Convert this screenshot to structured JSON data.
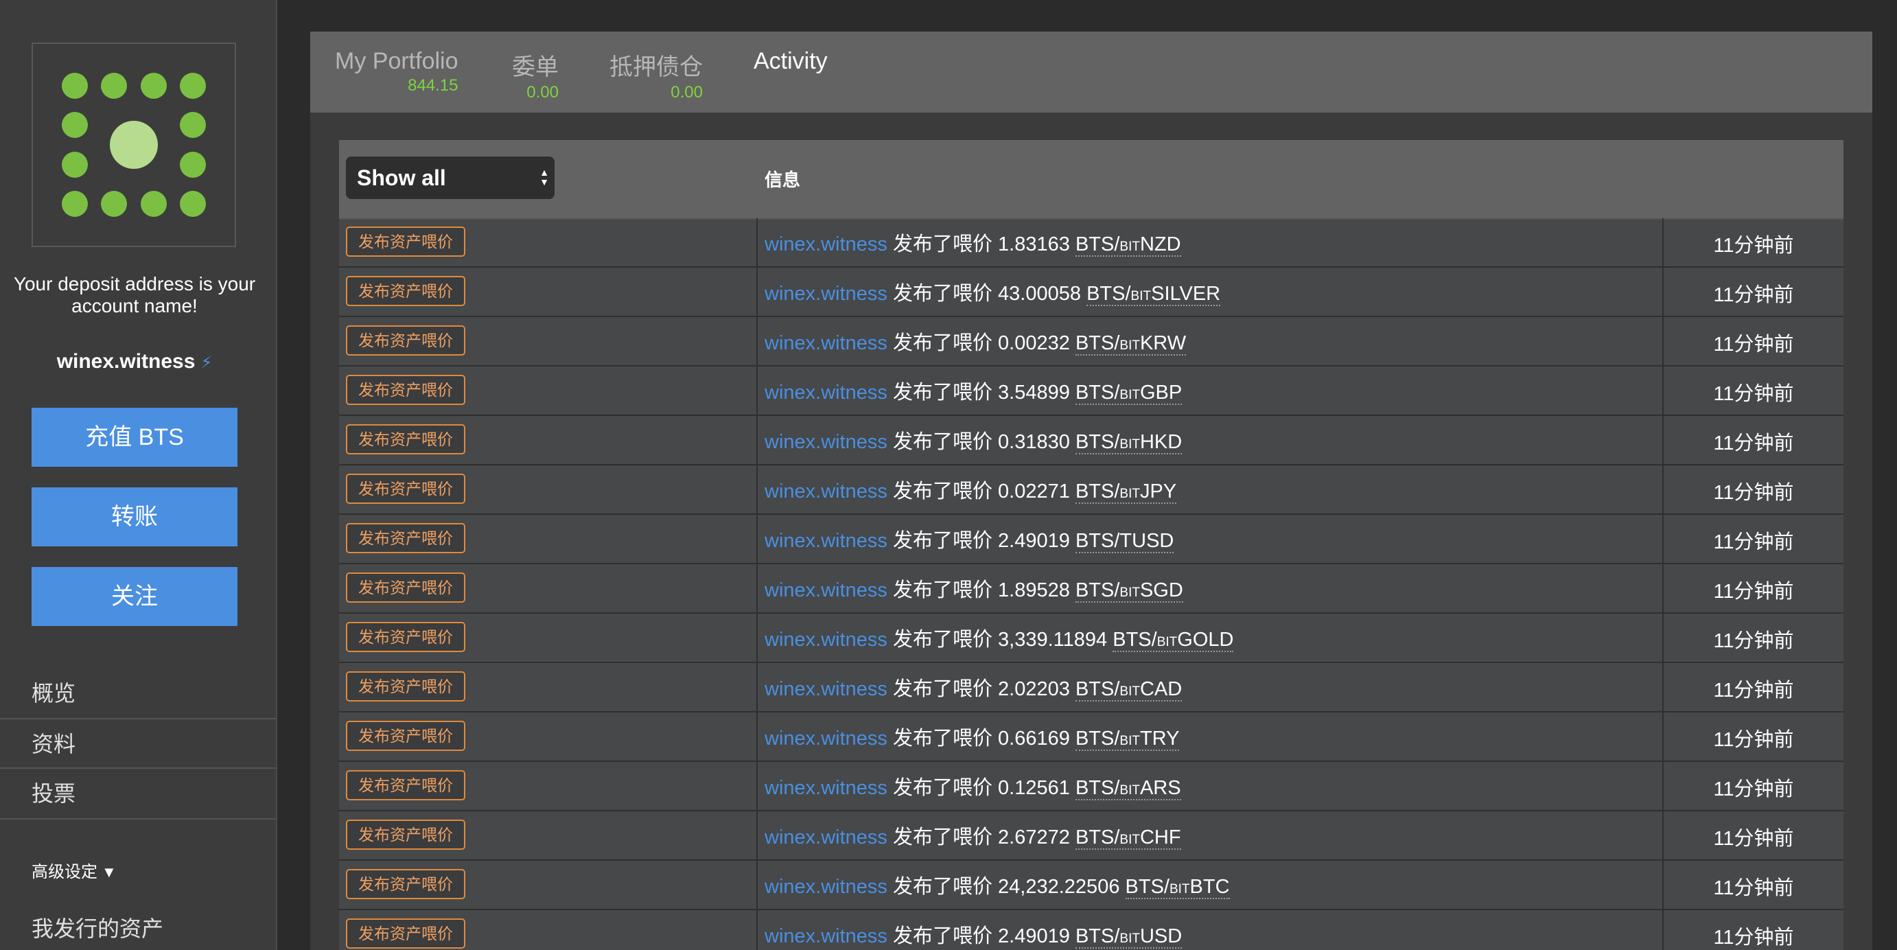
{
  "sidebar": {
    "deposit_text": "Your deposit address is your account name!",
    "account_name": "winex.witness",
    "buttons": [
      "充值 BTS",
      "转账",
      "关注"
    ],
    "nav": [
      "概览",
      "资料",
      "投票"
    ],
    "advanced_label": "高级设定",
    "advanced_arrow": "▼",
    "my_assets_label": "我发行的资产"
  },
  "tabs": [
    {
      "label": "My Portfolio",
      "value": "844.15",
      "active": false
    },
    {
      "label": "委单",
      "value": "0.00",
      "active": false
    },
    {
      "label": "抵押债仓",
      "value": "0.00",
      "active": false
    },
    {
      "label": "Activity",
      "value": "",
      "active": true
    }
  ],
  "table": {
    "filter_value": "Show all",
    "info_header": "信息",
    "operation_label": "发布资产喂价",
    "verb": "发布了喂价",
    "rows": [
      {
        "account": "winex.witness",
        "price": "1.83163",
        "base": "BTS/",
        "bit": "BIT",
        "asset": "NZD",
        "time": "11分钟前"
      },
      {
        "account": "winex.witness",
        "price": "43.00058",
        "base": "BTS/",
        "bit": "BIT",
        "asset": "SILVER",
        "time": "11分钟前"
      },
      {
        "account": "winex.witness",
        "price": "0.00232",
        "base": "BTS/",
        "bit": "BIT",
        "asset": "KRW",
        "time": "11分钟前"
      },
      {
        "account": "winex.witness",
        "price": "3.54899",
        "base": "BTS/",
        "bit": "BIT",
        "asset": "GBP",
        "time": "11分钟前"
      },
      {
        "account": "winex.witness",
        "price": "0.31830",
        "base": "BTS/",
        "bit": "BIT",
        "asset": "HKD",
        "time": "11分钟前"
      },
      {
        "account": "winex.witness",
        "price": "0.02271",
        "base": "BTS/",
        "bit": "BIT",
        "asset": "JPY",
        "time": "11分钟前"
      },
      {
        "account": "winex.witness",
        "price": "2.49019",
        "base": "BTS/",
        "bit": "",
        "asset": "TUSD",
        "time": "11分钟前"
      },
      {
        "account": "winex.witness",
        "price": "1.89528",
        "base": "BTS/",
        "bit": "BIT",
        "asset": "SGD",
        "time": "11分钟前"
      },
      {
        "account": "winex.witness",
        "price": "3,339.11894",
        "base": "BTS/",
        "bit": "BIT",
        "asset": "GOLD",
        "time": "11分钟前"
      },
      {
        "account": "winex.witness",
        "price": "2.02203",
        "base": "BTS/",
        "bit": "BIT",
        "asset": "CAD",
        "time": "11分钟前"
      },
      {
        "account": "winex.witness",
        "price": "0.66169",
        "base": "BTS/",
        "bit": "BIT",
        "asset": "TRY",
        "time": "11分钟前"
      },
      {
        "account": "winex.witness",
        "price": "0.12561",
        "base": "BTS/",
        "bit": "BIT",
        "asset": "ARS",
        "time": "11分钟前"
      },
      {
        "account": "winex.witness",
        "price": "2.67272",
        "base": "BTS/",
        "bit": "BIT",
        "asset": "CHF",
        "time": "11分钟前"
      },
      {
        "account": "winex.witness",
        "price": "24,232.22506",
        "base": "BTS/",
        "bit": "BIT",
        "asset": "BTC",
        "time": "11分钟前"
      },
      {
        "account": "winex.witness",
        "price": "2.49019",
        "base": "BTS/",
        "bit": "BIT",
        "asset": "USD",
        "time": "11分钟前"
      }
    ]
  },
  "colors": {
    "accent_blue": "#4a8fe0",
    "value_green": "#7ed33e",
    "badge_orange": "#e08a3c",
    "identicon_light": "#b7dc8f",
    "identicon_green": "#7bc043"
  }
}
